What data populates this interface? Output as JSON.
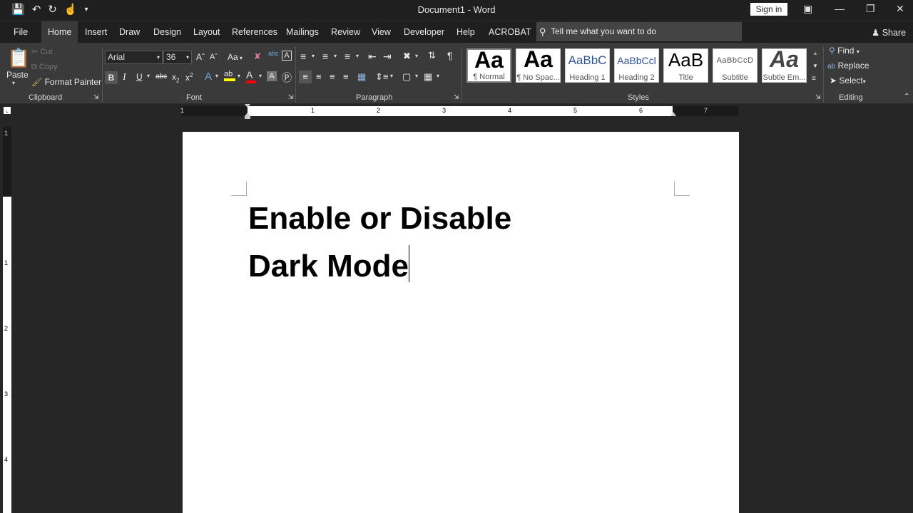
{
  "window": {
    "title": "Document1  -  Word",
    "sign_in": "Sign in"
  },
  "tabs": [
    "File",
    "Home",
    "Insert",
    "Draw",
    "Design",
    "Layout",
    "References",
    "Mailings",
    "Review",
    "View",
    "Developer",
    "Help",
    "ACROBAT"
  ],
  "tell_me": "Tell me what you want to do",
  "share": "Share",
  "clipboard": {
    "paste": "Paste",
    "cut": "Cut",
    "copy": "Copy",
    "format_painter": "Format Painter",
    "label": "Clipboard"
  },
  "font": {
    "name": "Arial",
    "size": "36",
    "label": "Font",
    "case": "Aa",
    "bold": "B",
    "italic": "I",
    "underline": "U",
    "strike": "abc"
  },
  "paragraph": {
    "label": "Paragraph"
  },
  "styles": {
    "label": "Styles",
    "items": [
      {
        "sample": "Aa",
        "name": "¶ Normal"
      },
      {
        "sample": "Aa",
        "name": "¶ No Spac..."
      },
      {
        "sample": "AaBbC",
        "name": "Heading 1"
      },
      {
        "sample": "AaBbCcl",
        "name": "Heading 2"
      },
      {
        "sample": "AaB",
        "name": "Title"
      },
      {
        "sample": "AaBbCcD",
        "name": "Subtitle"
      },
      {
        "sample": "Aa",
        "name": "Subtle Em..."
      }
    ]
  },
  "editing": {
    "find": "Find",
    "replace": "Replace",
    "select": "Select",
    "label": "Editing"
  },
  "ruler": {
    "h_numbers": [
      "1",
      "1",
      "2",
      "3",
      "4",
      "5",
      "6",
      "7"
    ],
    "v_numbers": [
      "1",
      "1",
      "2",
      "3",
      "4"
    ]
  },
  "document": {
    "line1": "Enable or Disable",
    "line2": "Dark Mode"
  },
  "colors": {
    "ribbon": "#3a3a3a",
    "titlebar": "#1f1f1f",
    "canvas": "#262626",
    "highlight": "#ffff00",
    "font_color": "#ff0000"
  }
}
